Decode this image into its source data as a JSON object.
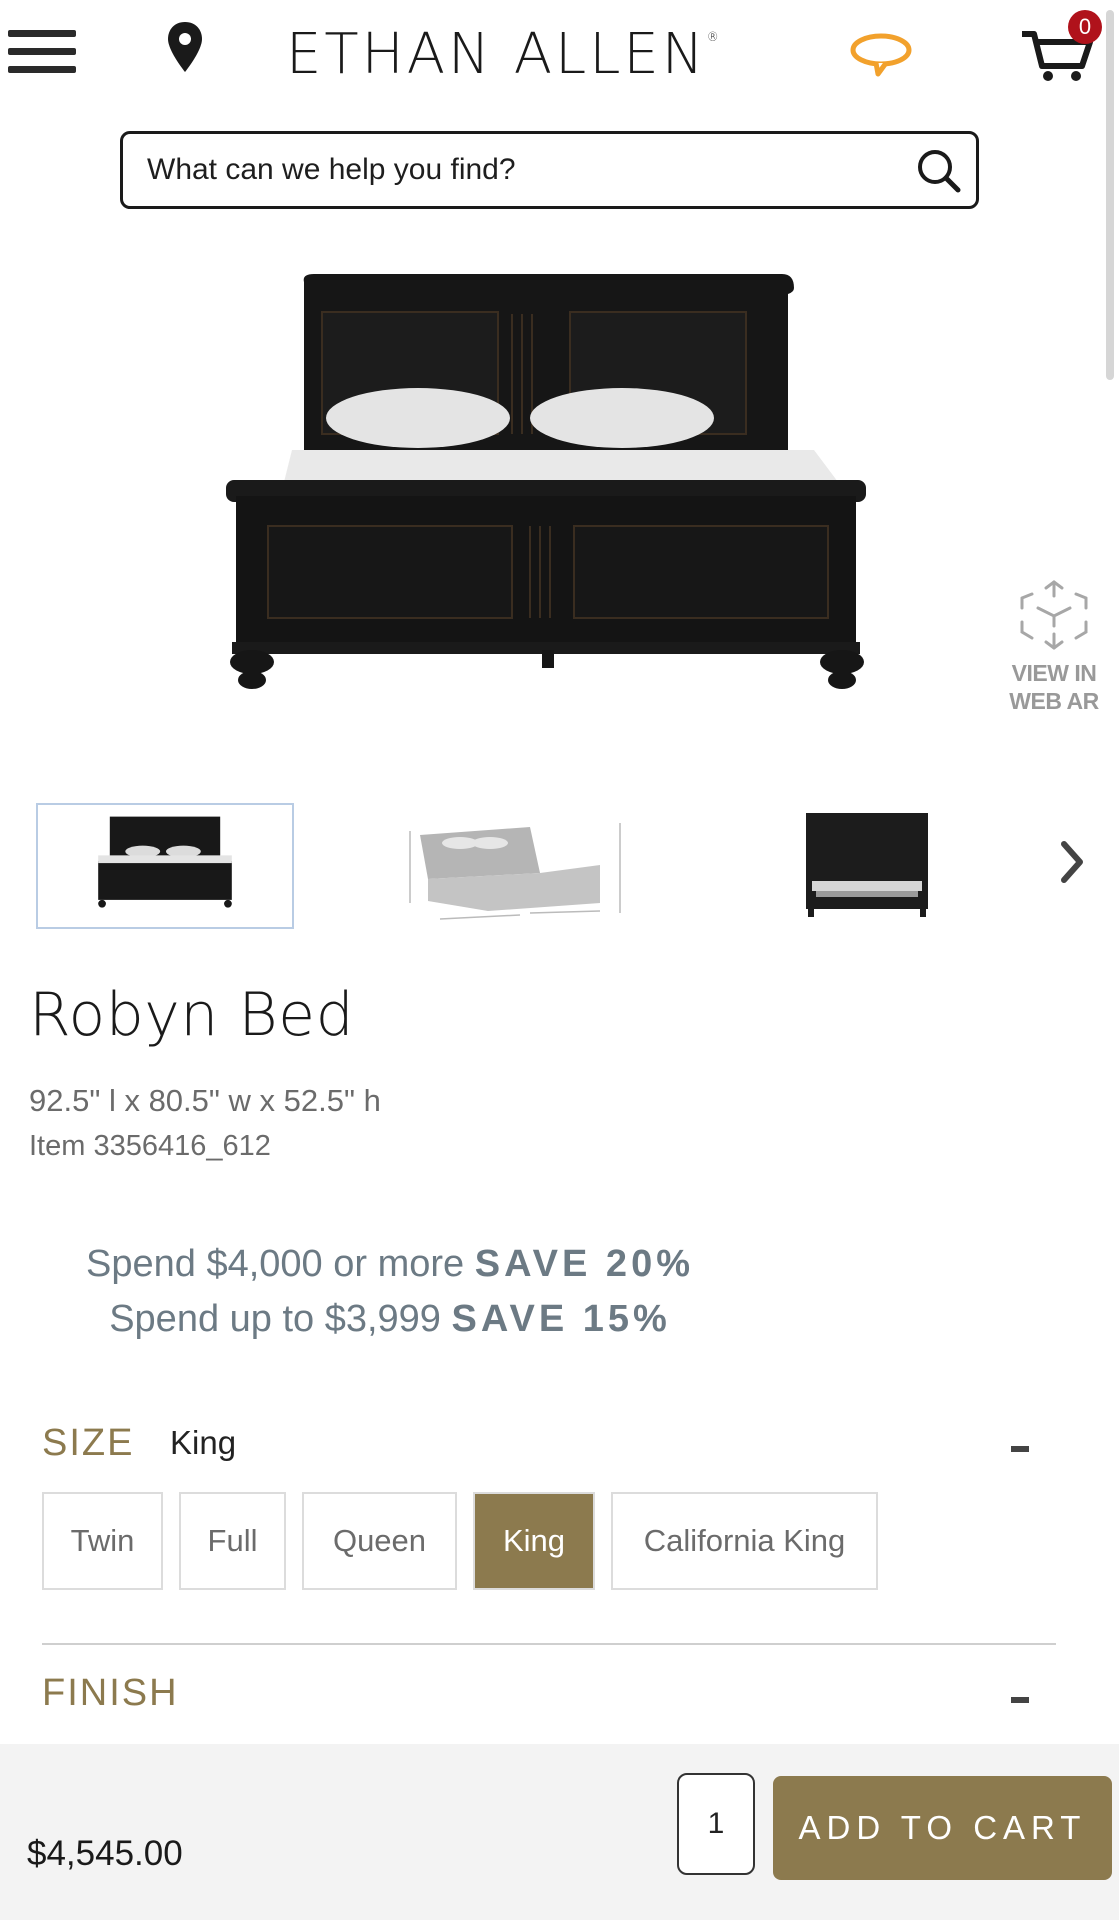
{
  "header": {
    "brand": "ETHAN ALLEN",
    "brand_mark": "®",
    "cart_count": "0",
    "icons": [
      "menu-icon",
      "location-pin-icon",
      "chat-icon",
      "cart-icon"
    ]
  },
  "search": {
    "placeholder": "What can we help you find?",
    "value": ""
  },
  "ar": {
    "line1": "VIEW IN",
    "line2": "WEB AR"
  },
  "product": {
    "name": "Robyn Bed",
    "dimensions": "92.5\" l x 80.5\" w x 52.5\" h",
    "item": "Item 3356416_612"
  },
  "promo": {
    "line1_text": "Spend $4,000 or more",
    "line1_save": "SAVE 20%",
    "line2_text": "Spend up to $3,999",
    "line2_save": "SAVE 15%"
  },
  "size": {
    "label": "SIZE",
    "selected": "King",
    "options": [
      "Twin",
      "Full",
      "Queen",
      "King",
      "California King"
    ]
  },
  "finish": {
    "label": "FINISH"
  },
  "purchase": {
    "price": "$4,545.00",
    "quantity": "1",
    "add_to_cart": "ADD TO CART"
  },
  "colors": {
    "accent": "#8c7a4e",
    "badge": "#b0121b",
    "chat": "#f2a12c"
  }
}
